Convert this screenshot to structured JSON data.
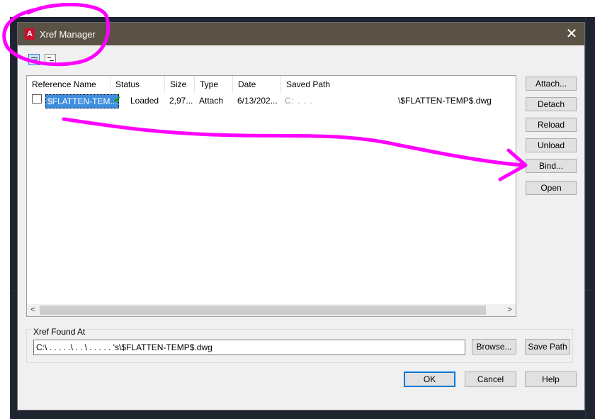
{
  "dialog": {
    "title": "Xref Manager",
    "app_icon_letter": "A",
    "close_glyph": "✕"
  },
  "view_toggles": {
    "list_view": "list-view-icon",
    "tree_view": "tree-view-icon"
  },
  "table": {
    "headers": {
      "reference_name": "Reference Name",
      "status": "Status",
      "size": "Size",
      "type": "Type",
      "date": "Date",
      "saved_path": "Saved Path"
    },
    "rows": [
      {
        "reference_name": "$FLATTEN-TEM...",
        "status": "Loaded",
        "size": "2,97...",
        "type": "Attach",
        "date": "6/13/202...",
        "saved_path_prefix": "C:  . . .",
        "saved_path_suffix": "\\$FLATTEN-TEMP$.dwg"
      }
    ]
  },
  "side_buttons": {
    "attach": "Attach...",
    "detach": "Detach",
    "reload": "Reload",
    "unload": "Unload",
    "bind": "Bind...",
    "open": "Open"
  },
  "found_at": {
    "label": "Xref Found At",
    "value": "C:\\  . .   .  . .\\ .  . \\ .  . .  . .  's\\$FLATTEN-TEMP$.dwg",
    "browse": "Browse...",
    "save_path": "Save Path"
  },
  "footer": {
    "ok": "OK",
    "cancel": "Cancel",
    "help": "Help"
  },
  "colors": {
    "annotation": "#ff00ff",
    "titlebar": "#5a5245",
    "selection": "#3d8ee0",
    "loaded_check": "#1a9b1a"
  }
}
